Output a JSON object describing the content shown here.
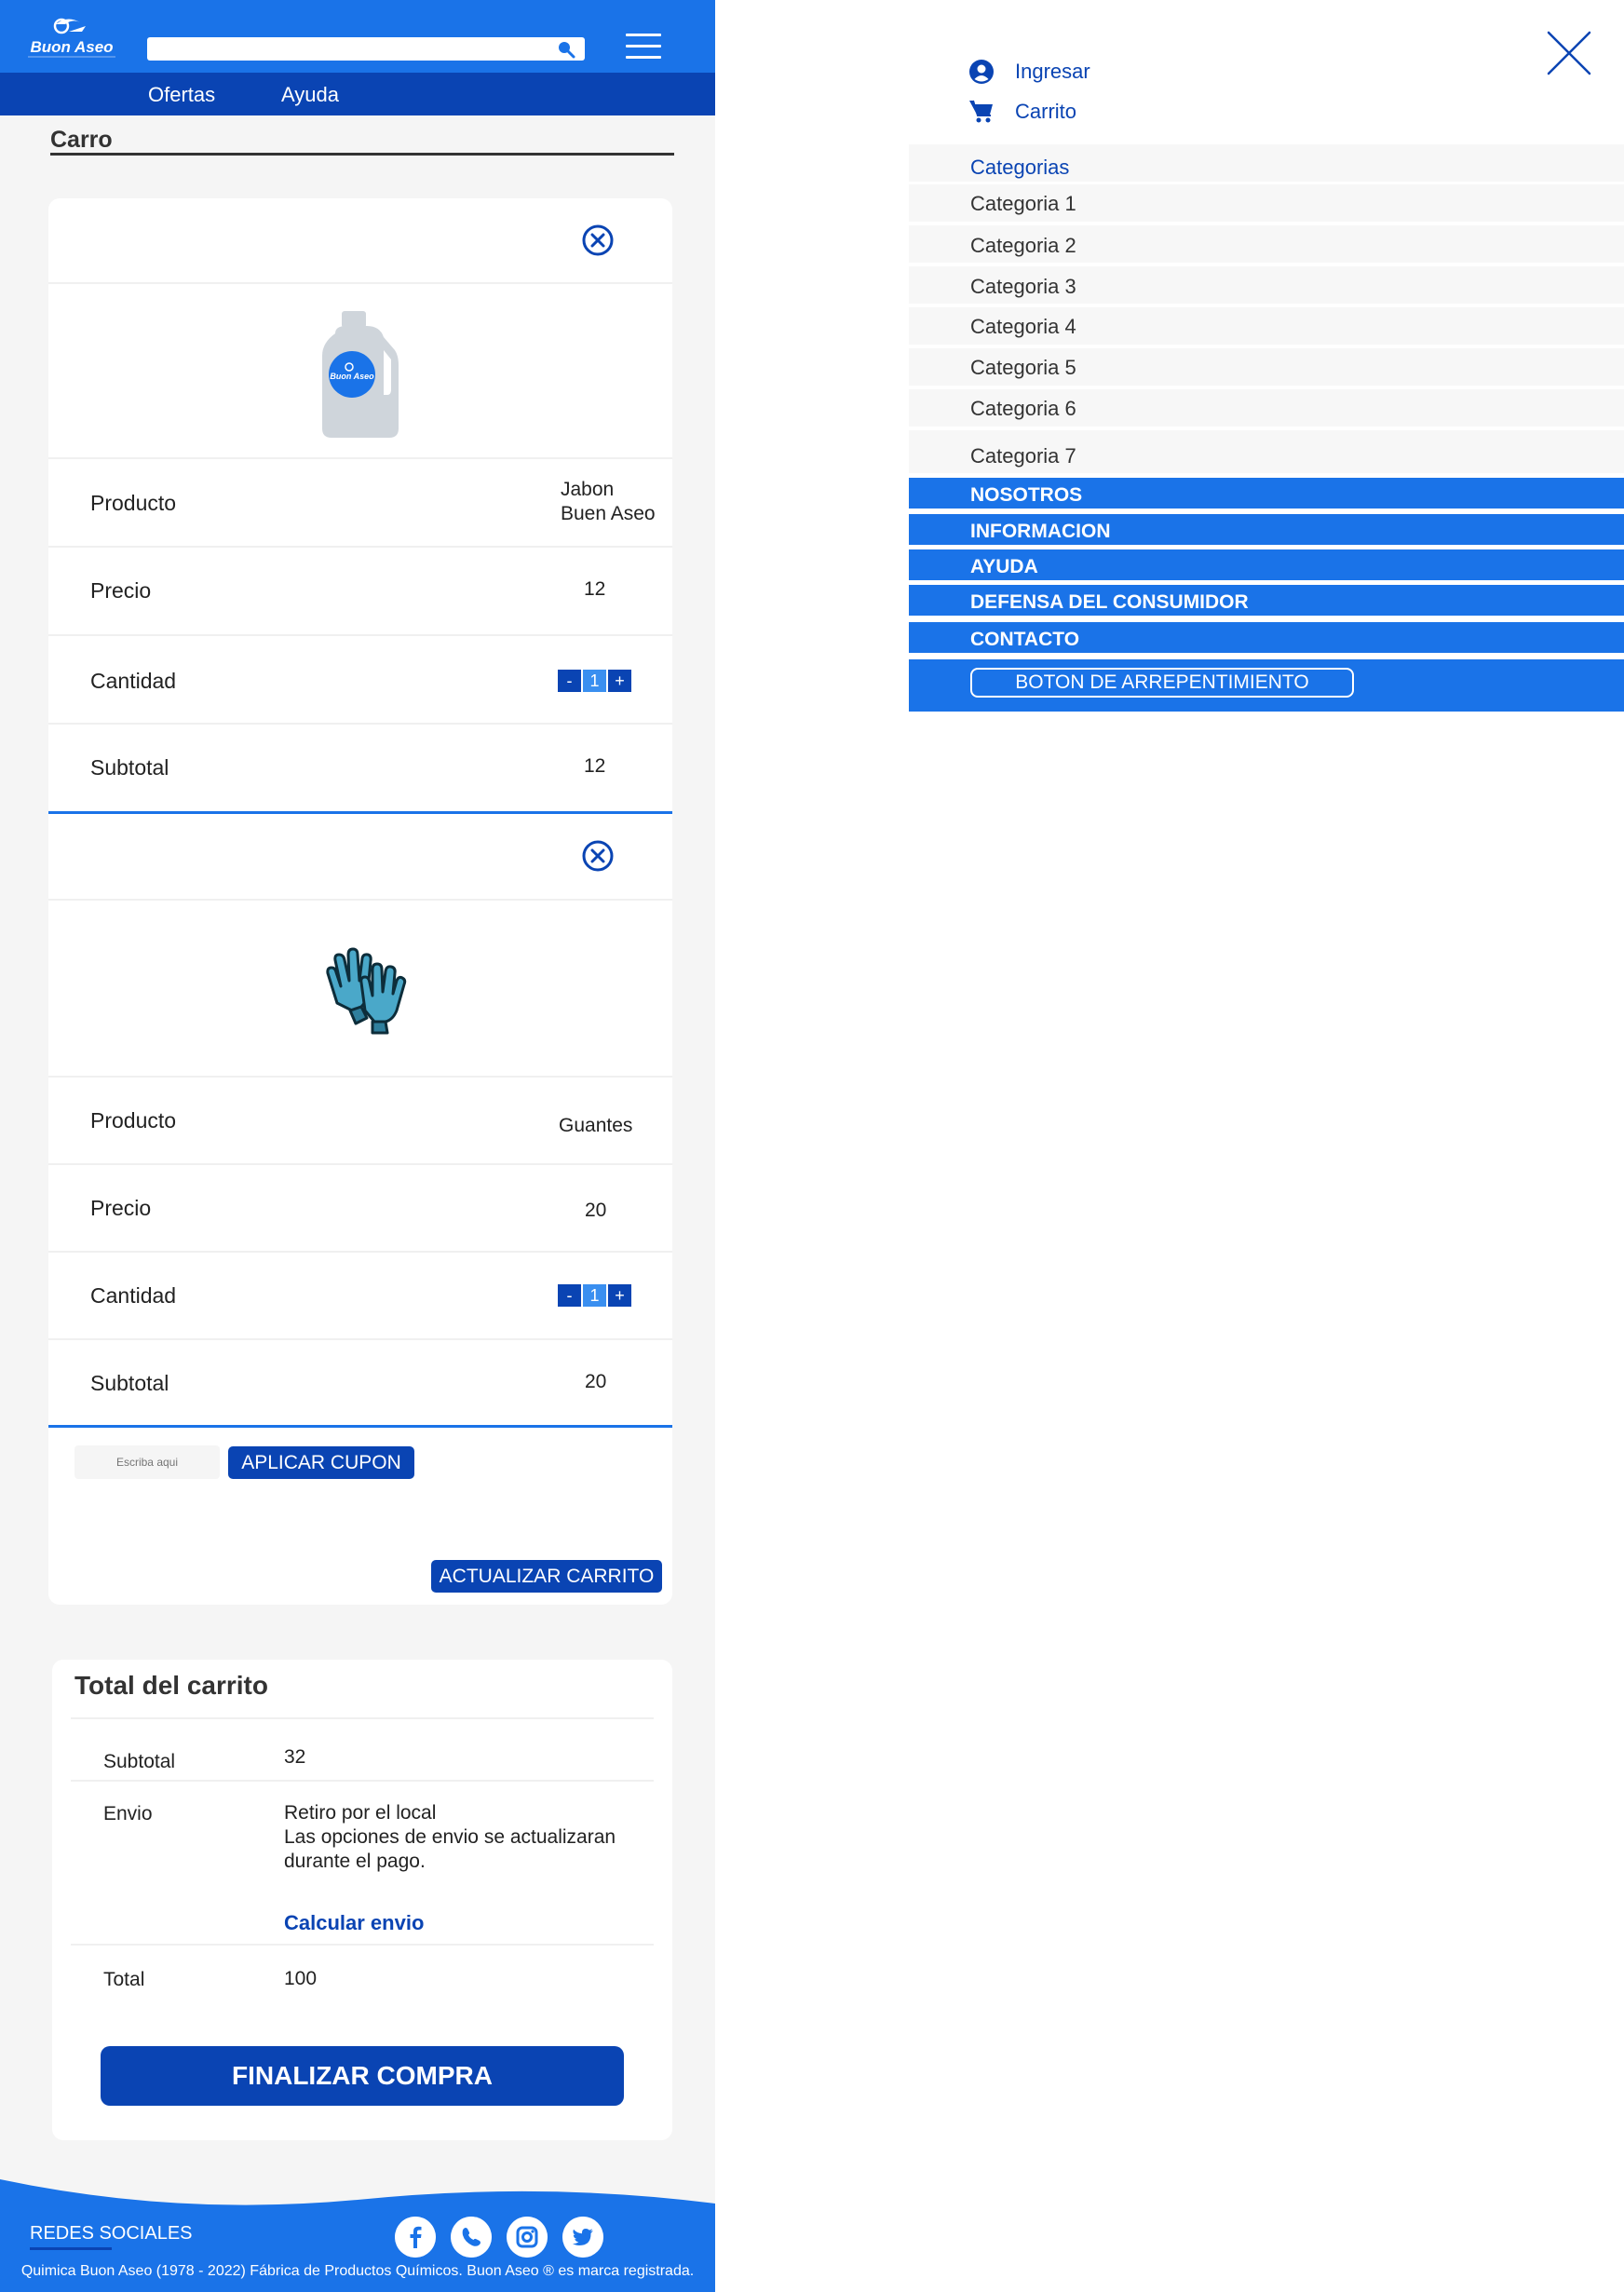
{
  "header": {
    "logo_text": "Buon Aseo",
    "nav": [
      "Ofertas",
      "Ayuda"
    ]
  },
  "cart": {
    "title": "Carro",
    "items": [
      {
        "image": "bottle-icon",
        "product_label": "Producto",
        "product_value": "Jabon\nBuen Aseo",
        "price_label": "Precio",
        "price_value": "12",
        "qty_label": "Cantidad",
        "qty_value": "1",
        "subtotal_label": "Subtotal",
        "subtotal_value": "12"
      },
      {
        "image": "gloves-icon",
        "product_label": "Producto",
        "product_value": "Guantes",
        "price_label": "Precio",
        "price_value": "20",
        "qty_label": "Cantidad",
        "qty_value": "1",
        "subtotal_label": "Subtotal",
        "subtotal_value": "20"
      }
    ],
    "qty_minus": "-",
    "qty_plus": "+",
    "coupon_placeholder": "Escriba aqui",
    "apply_coupon": "APLICAR CUPON",
    "update_cart": "ACTUALIZAR CARRITO"
  },
  "totals": {
    "title": "Total del carrito",
    "subtotal_label": "Subtotal",
    "subtotal_value": "32",
    "shipping_label": "Envio",
    "shipping_line1": "Retiro por el local",
    "shipping_line2": "Las opciones de envio se actualizaran",
    "shipping_line3": "durante el pago.",
    "calc_shipping": "Calcular envio",
    "total_label": "Total",
    "total_value": "100",
    "finish": "FINALIZAR COMPRA"
  },
  "footer": {
    "social_title": "REDES SOCIALES",
    "social_icons": [
      "facebook-icon",
      "whatsapp-icon",
      "instagram-icon",
      "twitter-icon"
    ],
    "copyright": "Quimica Buon Aseo (1978 - 2022) Fábrica de Productos Químicos. Buon Aseo ® es marca registrada."
  },
  "menu": {
    "login": "Ingresar",
    "cart": "Carrito",
    "categories_title": "Categorias",
    "categories": [
      "Categoria 1",
      "Categoria 2",
      "Categoria 3",
      "Categoria 4",
      "Categoria 5",
      "Categoria 6",
      "Categoria 7"
    ],
    "sections": [
      "NOSOTROS",
      "INFORMACION",
      "AYUDA",
      "DEFENSA DEL CONSUMIDOR",
      "CONTACTO"
    ],
    "regret_button": "BOTON DE ARREPENTIMIENTO"
  },
  "colors": {
    "primary": "#1a73e8",
    "dark_blue": "#0a44b3",
    "background": "#f5f5f5"
  }
}
